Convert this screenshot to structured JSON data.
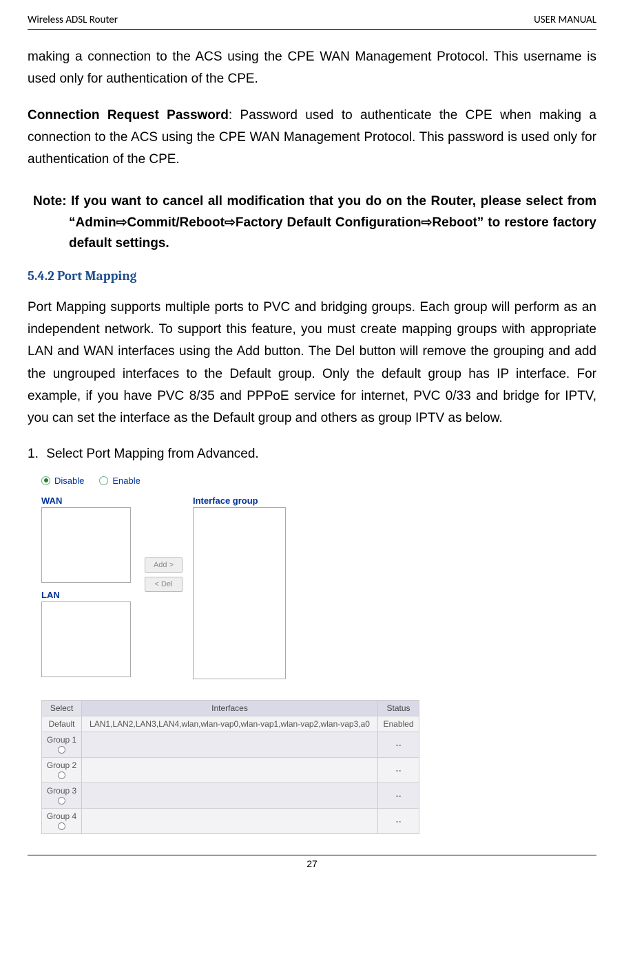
{
  "header": {
    "left": "Wireless ADSL Router",
    "right": "USER MANUAL"
  },
  "para1": "making a connection to the ACS using the CPE WAN Management Protocol. This username is used only for authentication of the CPE.",
  "para2_bold": "Connection Request Password",
  "para2_rest": ": Password used to authenticate the CPE when making a connection to the ACS using the CPE WAN Management Protocol. This password is used only for authentication of the CPE.",
  "note": {
    "prefix": "Note: ",
    "line1a": "If you want to cancel all modification that you do on the Router, please select from “Admin",
    "arrow": "⇨",
    "seg_commit": "Commit/Reboot",
    "seg_factory": "Factory Default Configuration",
    "seg_reboot": "Reboot” to restore factory default settings."
  },
  "section_heading": "5.4.2 Port Mapping",
  "section_body": "Port Mapping supports multiple ports to PVC and bridging groups. Each group will perform as an independent network. To support this feature, you must create mapping groups with appropriate LAN and WAN interfaces using the Add button. The Del button will remove the grouping and add the ungrouped interfaces to the Default group. Only the default group has IP interface. For example, if you have PVC 8/35 and PPPoE service for internet, PVC 0/33 and bridge for IPTV, you can set the interface as the Default group and others as group IPTV as below.",
  "step1_num": "1.",
  "step1_pre": "Select ",
  "step1_b1": "Port Mapping",
  "step1_mid": " from ",
  "step1_b2": "Advanced",
  "step1_end": ".",
  "ui": {
    "disable": "Disable",
    "enable": "Enable",
    "wan": "WAN",
    "lan": "LAN",
    "ifgroup": "Interface group",
    "add": "Add >",
    "del": "< Del"
  },
  "table": {
    "h_select": "Select",
    "h_interfaces": "Interfaces",
    "h_status": "Status",
    "rows": [
      {
        "select": "Default",
        "interfaces": "LAN1,LAN2,LAN3,LAN4,wlan,wlan-vap0,wlan-vap1,wlan-vap2,wlan-vap3,a0",
        "status": "Enabled",
        "radio": false
      },
      {
        "select": "Group 1",
        "interfaces": "",
        "status": "--",
        "radio": true
      },
      {
        "select": "Group 2",
        "interfaces": "",
        "status": "--",
        "radio": true
      },
      {
        "select": "Group 3",
        "interfaces": "",
        "status": "--",
        "radio": true
      },
      {
        "select": "Group 4",
        "interfaces": "",
        "status": "--",
        "radio": true
      }
    ]
  },
  "footer_page": "27"
}
